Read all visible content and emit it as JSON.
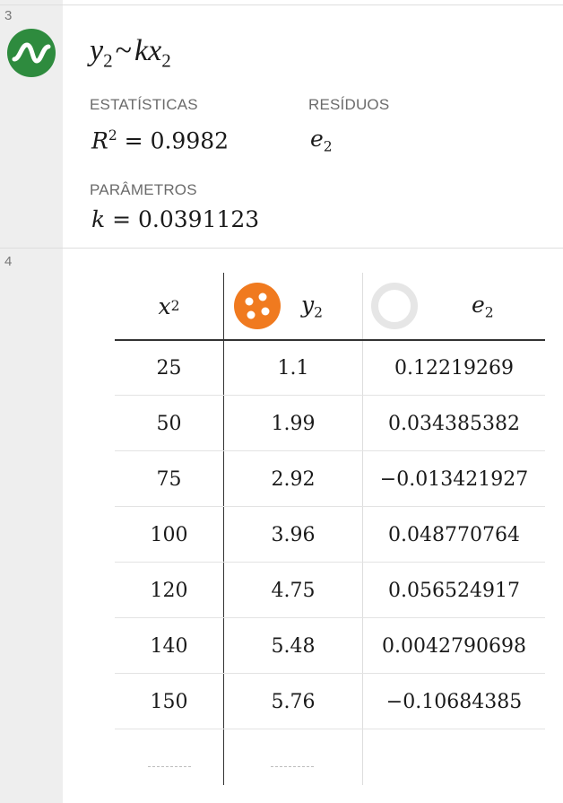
{
  "rows": [
    {
      "number": "3"
    },
    {
      "number": "4"
    }
  ],
  "regression": {
    "formula": {
      "y": "y",
      "y_sub": "2",
      "tilde": "~",
      "k": "k",
      "x": "x",
      "x_sub": "2"
    },
    "statistics_label": "ESTATÍSTICAS",
    "residuals_label": "RESÍDUOS",
    "r2": {
      "var": "R",
      "exp": "2",
      "eq": "=",
      "value": "0.9982"
    },
    "residual_var": {
      "var": "e",
      "sub": "2"
    },
    "parameters_label": "PARÂMETROS",
    "param": {
      "var": "k",
      "eq": "=",
      "value": "0.0391123"
    },
    "icon_color": "#2e8b3e"
  },
  "table": {
    "columns": [
      {
        "var": "x",
        "sub": "2"
      },
      {
        "var": "y",
        "sub": "2",
        "icon": "point-style-icon",
        "icon_color": "#f07a1f"
      },
      {
        "var": "e",
        "sub": "2",
        "icon": "hidden-point-style-icon"
      }
    ],
    "rows": [
      [
        "25",
        "1.1",
        "0.12219269"
      ],
      [
        "50",
        "1.99",
        "0.034385382"
      ],
      [
        "75",
        "2.92",
        "−0.013421927"
      ],
      [
        "100",
        "3.96",
        "0.048770764"
      ],
      [
        "120",
        "4.75",
        "0.056524917"
      ],
      [
        "140",
        "5.48",
        "0.0042790698"
      ],
      [
        "150",
        "5.76",
        "−0.10684385"
      ]
    ]
  }
}
